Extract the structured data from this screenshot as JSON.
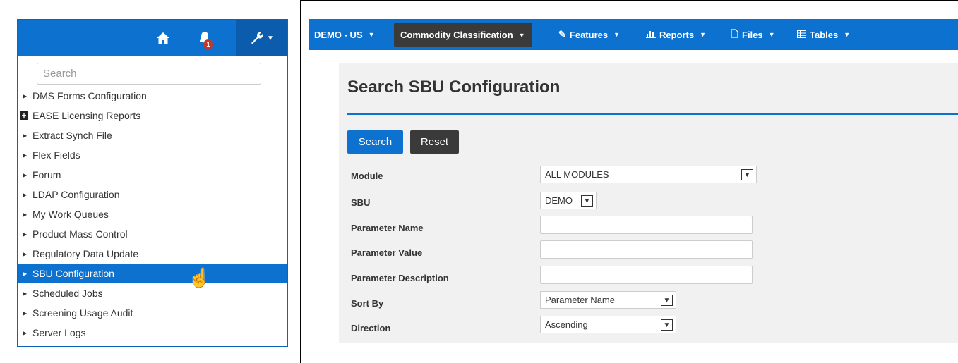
{
  "left_panel": {
    "search_placeholder": "Search",
    "notification_count": "1",
    "menu_items": [
      {
        "label": "DMS Forms Configuration"
      },
      {
        "label": "EASE Licensing Reports"
      },
      {
        "label": "Extract Synch File"
      },
      {
        "label": "Flex Fields"
      },
      {
        "label": "Forum"
      },
      {
        "label": "LDAP Configuration"
      },
      {
        "label": "My Work Queues"
      },
      {
        "label": "Product Mass Control"
      },
      {
        "label": "Regulatory Data Update"
      },
      {
        "label": "SBU Configuration"
      },
      {
        "label": "Scheduled Jobs"
      },
      {
        "label": "Screening Usage Audit"
      },
      {
        "label": "Server Logs"
      }
    ]
  },
  "top_nav": {
    "demo": "DEMO - US",
    "commodity": "Commodity Classification",
    "features": "Features",
    "reports": "Reports",
    "files": "Files",
    "tables": "Tables"
  },
  "main": {
    "title": "Search SBU Configuration",
    "search_button": "Search",
    "reset_button": "Reset",
    "fields": {
      "module_label": "Module",
      "module_value": "ALL MODULES",
      "sbu_label": "SBU",
      "sbu_value": "DEMO",
      "param_name_label": "Parameter Name",
      "param_value_label": "Parameter Value",
      "param_desc_label": "Parameter Description",
      "sort_by_label": "Sort By",
      "sort_by_value": "Parameter Name",
      "direction_label": "Direction",
      "direction_value": "Ascending"
    }
  },
  "colors": {
    "primary_blue": "#0d71d0",
    "dark_button": "#3a3a3a",
    "badge_red": "#c0392b"
  }
}
